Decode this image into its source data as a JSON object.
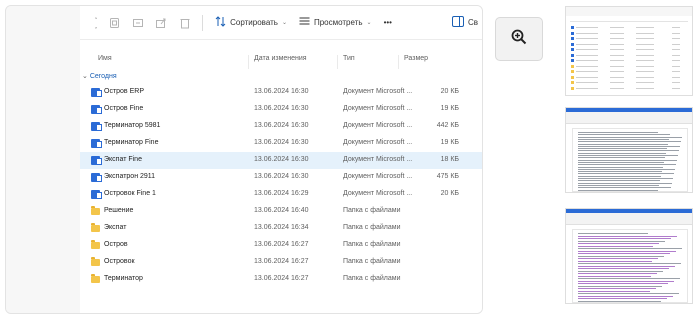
{
  "toolbar": {
    "sort_label": "Сортировать",
    "view_label": "Просмотреть",
    "more_label": "•••",
    "right_label": "Св"
  },
  "headers": {
    "name": "Имя",
    "date": "Дата изменения",
    "type": "Тип",
    "size": "Размер"
  },
  "group_label": "Сегодня",
  "files": [
    {
      "name": "Остров ERP",
      "date": "13.06.2024 16:30",
      "type": "Документ Microsoft ...",
      "size": "20 КБ",
      "kind": "doc"
    },
    {
      "name": "Остров Fine",
      "date": "13.06.2024 16:30",
      "type": "Документ Microsoft ...",
      "size": "19 КБ",
      "kind": "doc"
    },
    {
      "name": "Терминатор 5981",
      "date": "13.06.2024 16:30",
      "type": "Документ Microsoft ...",
      "size": "442 КБ",
      "kind": "doc"
    },
    {
      "name": "Терминатор Fine",
      "date": "13.06.2024 16:30",
      "type": "Документ Microsoft ...",
      "size": "19 КБ",
      "kind": "doc"
    },
    {
      "name": "Экспат Fine",
      "date": "13.06.2024 16:30",
      "type": "Документ Microsoft ...",
      "size": "18 КБ",
      "kind": "doc",
      "selected": true
    },
    {
      "name": "Экспатрон 2911",
      "date": "13.06.2024 16:30",
      "type": "Документ Microsoft ...",
      "size": "475 КБ",
      "kind": "doc"
    },
    {
      "name": "Островок Fine 1",
      "date": "13.06.2024 16:29",
      "type": "Документ Microsoft ...",
      "size": "20 КБ",
      "kind": "doc"
    },
    {
      "name": "Решение",
      "date": "13.06.2024 16:40",
      "type": "Папка с файлами",
      "size": "",
      "kind": "folder"
    },
    {
      "name": "Экспат",
      "date": "13.06.2024 16:34",
      "type": "Папка с файлами",
      "size": "",
      "kind": "folder"
    },
    {
      "name": "Остров",
      "date": "13.06.2024 16:27",
      "type": "Папка с файлами",
      "size": "",
      "kind": "folder"
    },
    {
      "name": "Островок",
      "date": "13.06.2024 16:27",
      "type": "Папка с файлами",
      "size": "",
      "kind": "folder"
    },
    {
      "name": "Терминатор",
      "date": "13.06.2024 16:27",
      "type": "Папка с файлами",
      "size": "",
      "kind": "folder"
    }
  ],
  "colors": {
    "accent": "#1a5fb4",
    "selected_row": "#e5f1fb",
    "doc_icon": "#2b6bd6",
    "folder_icon": "#f3c54a"
  },
  "icons": {
    "zoom": "zoom-in-icon",
    "sort": "sort-icon",
    "view": "view-icon"
  }
}
